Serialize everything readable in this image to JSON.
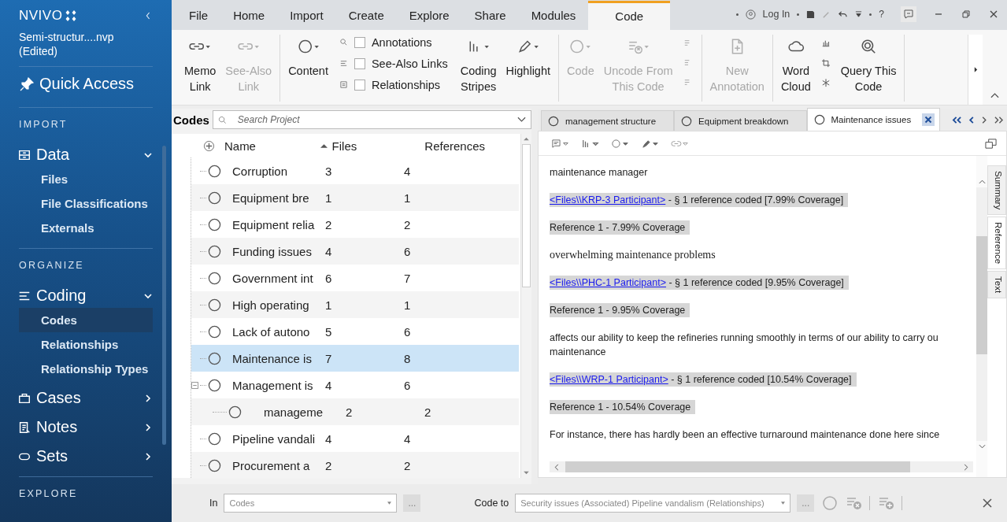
{
  "sidebar": {
    "logo": "NVIVO",
    "project": "Semi-structur....nvp",
    "project_status": "(Edited)",
    "quick_access": "Quick Access",
    "sections": [
      {
        "heading": "IMPORT",
        "groups": [
          {
            "label": "Data",
            "expanded": true,
            "items": [
              {
                "label": "Files",
                "selected": false
              },
              {
                "label": "File Classifications",
                "selected": false
              },
              {
                "label": "Externals",
                "selected": false
              }
            ]
          }
        ]
      },
      {
        "heading": "ORGANIZE",
        "groups": [
          {
            "label": "Coding",
            "expanded": true,
            "items": [
              {
                "label": "Codes",
                "selected": true
              },
              {
                "label": "Relationships",
                "selected": false
              },
              {
                "label": "Relationship Types",
                "selected": false
              }
            ]
          },
          {
            "label": "Cases",
            "expanded": false
          },
          {
            "label": "Notes",
            "expanded": false
          },
          {
            "label": "Sets",
            "expanded": false
          }
        ]
      },
      {
        "heading": "EXPLORE"
      }
    ]
  },
  "ribbon": {
    "tabs": [
      {
        "label": "File",
        "selected": false
      },
      {
        "label": "Home",
        "selected": false
      },
      {
        "label": "Import",
        "selected": false
      },
      {
        "label": "Create",
        "selected": false
      },
      {
        "label": "Explore",
        "selected": false
      },
      {
        "label": "Share",
        "selected": false
      },
      {
        "label": "Modules",
        "selected": false
      },
      {
        "label": "Code",
        "selected": true
      }
    ],
    "login": "Log In",
    "help": "?",
    "groups": [
      {
        "items": [
          {
            "kind": "button",
            "label": "Memo\nLink",
            "disabled": false
          },
          {
            "kind": "button",
            "label": "See-Also\nLink",
            "disabled": true
          }
        ]
      },
      {
        "items": [
          {
            "kind": "button",
            "label": "Content",
            "disabled": false
          },
          {
            "kind": "checks",
            "options": [
              {
                "label": "Annotations",
                "checked": false
              },
              {
                "label": "See-Also Links",
                "checked": false
              },
              {
                "label": "Relationships",
                "checked": false
              }
            ]
          },
          {
            "kind": "button",
            "label": "Coding\nStripes",
            "disabled": false
          },
          {
            "kind": "button",
            "label": "Highlight",
            "disabled": false
          }
        ]
      },
      {
        "items": [
          {
            "kind": "button",
            "label": "Code",
            "disabled": true
          },
          {
            "kind": "button",
            "label": "Uncode From\nThis Code",
            "disabled": true
          },
          {
            "kind": "mini",
            "disabled": true
          }
        ]
      },
      {
        "items": [
          {
            "kind": "button",
            "label": "New\nAnnotation",
            "disabled": true
          }
        ]
      },
      {
        "items": [
          {
            "kind": "button",
            "label": "Word\nCloud",
            "disabled": false
          },
          {
            "kind": "mini",
            "disabled": false
          },
          {
            "kind": "button",
            "label": "Query This\nCode",
            "disabled": false
          }
        ]
      }
    ]
  },
  "codes": {
    "title": "Codes",
    "search": {
      "placeholder": "Search Project"
    },
    "columns": [
      "Name",
      "Files",
      "References"
    ],
    "rows": [
      {
        "name": "Corruption",
        "files": "3",
        "references": "4",
        "selected": false
      },
      {
        "name": "Equipment bre",
        "files": "1",
        "references": "1",
        "selected": false
      },
      {
        "name": "Equipment relia",
        "files": "2",
        "references": "2",
        "selected": false
      },
      {
        "name": "Funding issues",
        "files": "4",
        "references": "6",
        "selected": false
      },
      {
        "name": "Government int",
        "files": "6",
        "references": "7",
        "selected": false
      },
      {
        "name": "High operating",
        "files": "1",
        "references": "1",
        "selected": false
      },
      {
        "name": "Lack of autono",
        "files": "5",
        "references": "6",
        "selected": false
      },
      {
        "name": "Maintenance is",
        "files": "7",
        "references": "8",
        "selected": true
      },
      {
        "name": "Management is",
        "files": "4",
        "references": "6",
        "selected": false,
        "expanded": true,
        "children": [
          {
            "name": "manageme",
            "files": "2",
            "references": "2",
            "selected": false
          }
        ]
      },
      {
        "name": "Pipeline vandali",
        "files": "4",
        "references": "4",
        "selected": false
      },
      {
        "name": "Procurement a",
        "files": "2",
        "references": "2",
        "selected": false
      }
    ]
  },
  "detail": {
    "tabs": [
      {
        "label": "management structure",
        "selected": false
      },
      {
        "label": "Equipment breakdown",
        "selected": false
      },
      {
        "label": "Maintenance issues",
        "selected": true
      }
    ],
    "side_tabs": [
      {
        "label": "Summary",
        "selected": false
      },
      {
        "label": "Reference",
        "selected": true
      },
      {
        "label": "Text",
        "selected": false
      }
    ],
    "content": [
      {
        "kind": "text",
        "lines": [
          "maintenance manager"
        ]
      },
      {
        "kind": "source",
        "link": "<Files\\\\KRP-3 Participant>",
        "text": " - § 1 reference coded  [7.99% Coverage]"
      },
      {
        "kind": "ref",
        "text": "Reference 1 - 7.99% Coverage"
      },
      {
        "kind": "serif",
        "lines": [
          "overwhelming maintenance problems"
        ]
      },
      {
        "kind": "source",
        "link": "<Files\\\\PHC-1 Participant>",
        "text": " - § 1 reference coded  [9.95% Coverage]"
      },
      {
        "kind": "ref",
        "text": "Reference 1 - 9.95% Coverage"
      },
      {
        "kind": "text",
        "lines": [
          "affects our ability to keep the refineries running smoothly in terms of our ability to carry ou",
          "maintenance"
        ]
      },
      {
        "kind": "source",
        "link": "<Files\\\\WRP-1 Participant>",
        "text": " - § 1 reference coded  [10.54% Coverage]"
      },
      {
        "kind": "ref",
        "text": "Reference 1 - 10.54% Coverage"
      },
      {
        "kind": "text",
        "lines": [
          "For instance, there has hardly been an effective turnaround maintenance done here since"
        ]
      }
    ]
  },
  "bottom_bar": {
    "in_label": "In",
    "in_value": "Codes",
    "more": "...",
    "code_to_label": "Code to",
    "code_to_value": "Security issues (Associated) Pipeline vandalism (Relationships)",
    "more_2": "..."
  }
}
